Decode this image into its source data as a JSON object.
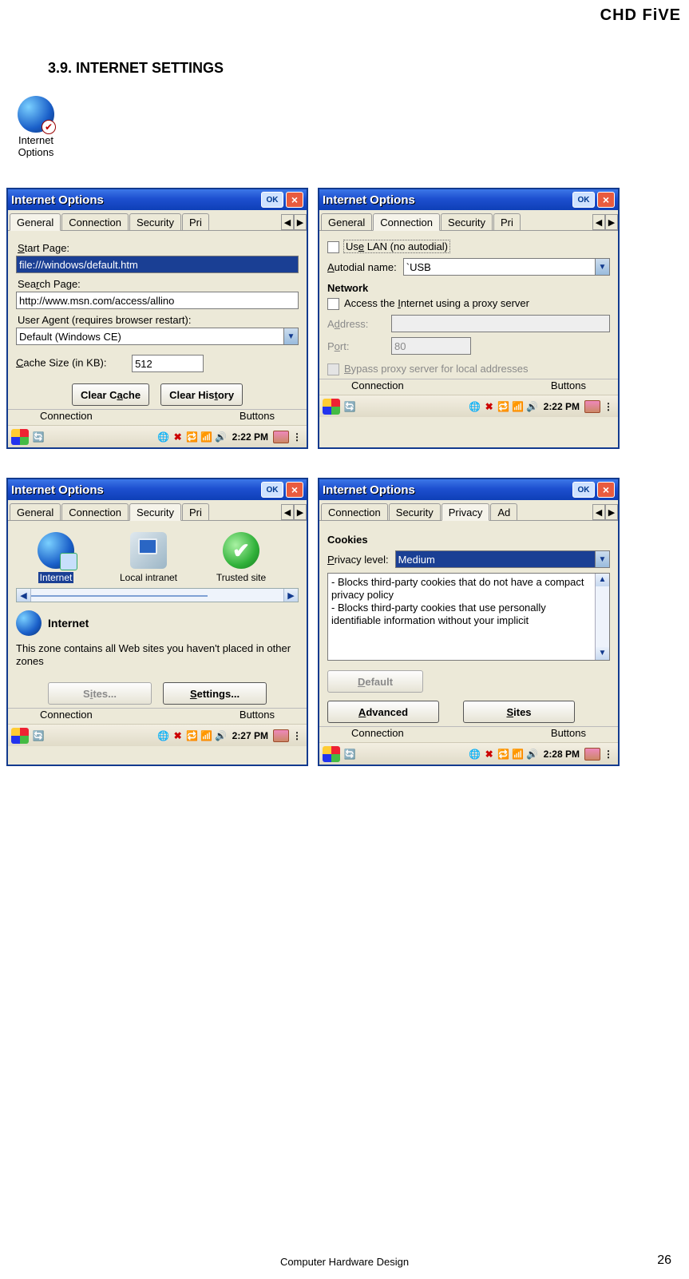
{
  "header_right": "CHD FiVE",
  "section_heading": "3.9. INTERNET SETTINGS",
  "icon_caption": "Internet Options",
  "footer_text": "Computer Hardware Design",
  "page_number": "26",
  "dialogs": {
    "title": "Internet Options",
    "ok": "OK",
    "close": "×",
    "belowstrip_left": "Connection",
    "belowstrip_right": "Buttons"
  },
  "general": {
    "tabs": [
      "General",
      "Connection",
      "Security",
      "Pri"
    ],
    "start_page_label": "Start Page:",
    "start_page_value": "file:///windows/default.htm",
    "search_page_label": "Search Page:",
    "search_page_value": "http://www.msn.com/access/allino",
    "user_agent_label": "User Agent (requires browser restart):",
    "user_agent_value": "Default (Windows CE)",
    "cache_label": "Cache Size (in KB):",
    "cache_value": "512",
    "clear_cache": "Clear Cache",
    "clear_history": "Clear History",
    "time": "2:22 PM"
  },
  "connection": {
    "tabs": [
      "General",
      "Connection",
      "Security",
      "Pri"
    ],
    "use_lan": "Use LAN (no autodial)",
    "autodial_label": "Autodial name:",
    "autodial_value": "`USB",
    "network_heading": "Network",
    "proxy_label": "Access the Internet using a proxy server",
    "address_label": "Address:",
    "address_value": "",
    "port_label": "Port:",
    "port_value": "80",
    "bypass_label": "Bypass proxy server for local addresses",
    "time": "2:22 PM"
  },
  "security": {
    "tabs": [
      "General",
      "Connection",
      "Security",
      "Pri"
    ],
    "zones": {
      "internet": "Internet",
      "local": "Local intranet",
      "trusted": "Trusted site"
    },
    "zone_title": "Internet",
    "zone_desc": "This zone contains all Web sites you haven't placed in other zones",
    "sites_btn": "Sites...",
    "settings_btn": "Settings...",
    "time": "2:27 PM"
  },
  "privacy": {
    "tabs": [
      "Connection",
      "Security",
      "Privacy",
      "Ad"
    ],
    "cookies_heading": "Cookies",
    "level_label": "Privacy level:",
    "level_value": "Medium",
    "desc": "- Blocks third-party cookies that do not have a compact privacy policy\n- Blocks third-party cookies that use personally identifiable information without your implicit",
    "default_btn": "Default",
    "advanced_btn": "Advanced",
    "sites_btn": "Sites",
    "time": "2:28 PM"
  }
}
